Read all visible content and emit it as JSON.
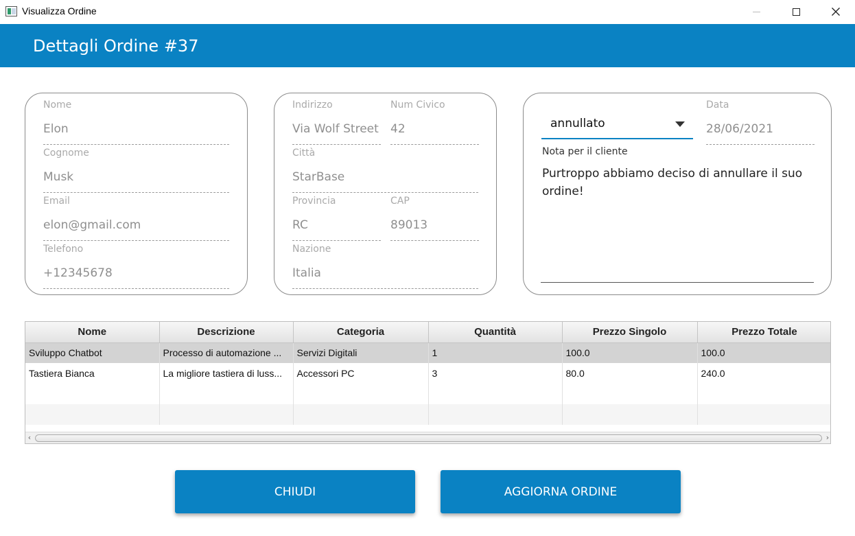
{
  "window": {
    "title": "Visualizza Ordine"
  },
  "header": {
    "title": "Dettagli Ordine #37"
  },
  "customer": {
    "name_label": "Nome",
    "name_value": "Elon",
    "surname_label": "Cognome",
    "surname_value": "Musk",
    "email_label": "Email",
    "email_value": "elon@gmail.com",
    "phone_label": "Telefono",
    "phone_value": "+12345678"
  },
  "address": {
    "street_label": "Indirizzo",
    "street_value": "Via Wolf Street",
    "number_label": "Num Civico",
    "number_value": "42",
    "city_label": "Città",
    "city_value": "StarBase",
    "province_label": "Provincia",
    "province_value": "RC",
    "cap_label": "CAP",
    "cap_value": "89013",
    "country_label": "Nazione",
    "country_value": "Italia"
  },
  "order": {
    "status_value": "annullato",
    "date_label": "Data",
    "date_value": "28/06/2021",
    "note_label": "Nota per il cliente",
    "note_text": "Purtroppo abbiamo deciso di annullare il suo ordine!"
  },
  "table": {
    "columns": [
      "Nome",
      "Descrizione",
      "Categoria",
      "Quantità",
      "Prezzo Singolo",
      "Prezzo Totale"
    ],
    "rows": [
      [
        "Sviluppo Chatbot",
        "Processo di automazione ...",
        "Servizi Digitali",
        "1",
        "100.0",
        "100.0"
      ],
      [
        "Tastiera Bianca",
        "La migliore tastiera di luss...",
        "Accessori PC",
        "3",
        "80.0",
        "240.0"
      ]
    ],
    "selected_row": 0
  },
  "buttons": {
    "close_label": "CHIUDI",
    "update_label": "AGGIORNA ORDINE"
  },
  "colors": {
    "accent": "#0a82c3",
    "selected_row": "#d3d3d3"
  },
  "icons": {
    "app": "app-window-icon",
    "minimize": "minimize-icon",
    "maximize": "maximize-icon",
    "close": "close-icon",
    "dropdown": "chevron-down-icon"
  }
}
